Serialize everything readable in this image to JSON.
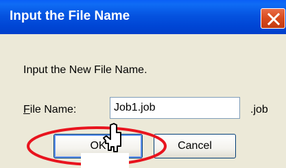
{
  "dialog": {
    "title": "Input the File Name",
    "close_icon": "close-icon",
    "message": "Input the New File Name.",
    "file_name_label_accel": "F",
    "file_name_label_rest": "ile Name:",
    "file_name_value": "Job1.job",
    "extension": ".job",
    "ok_label": "OK",
    "cancel_label": "Cancel"
  },
  "colors": {
    "titlebar": "#0055e5",
    "close_button": "#d84a1d",
    "body": "#ece9d8",
    "highlight": "#e8141e"
  },
  "annotations": {
    "highlight_shape": "red-ellipse",
    "pointer_icon": "hand-cursor-icon"
  }
}
